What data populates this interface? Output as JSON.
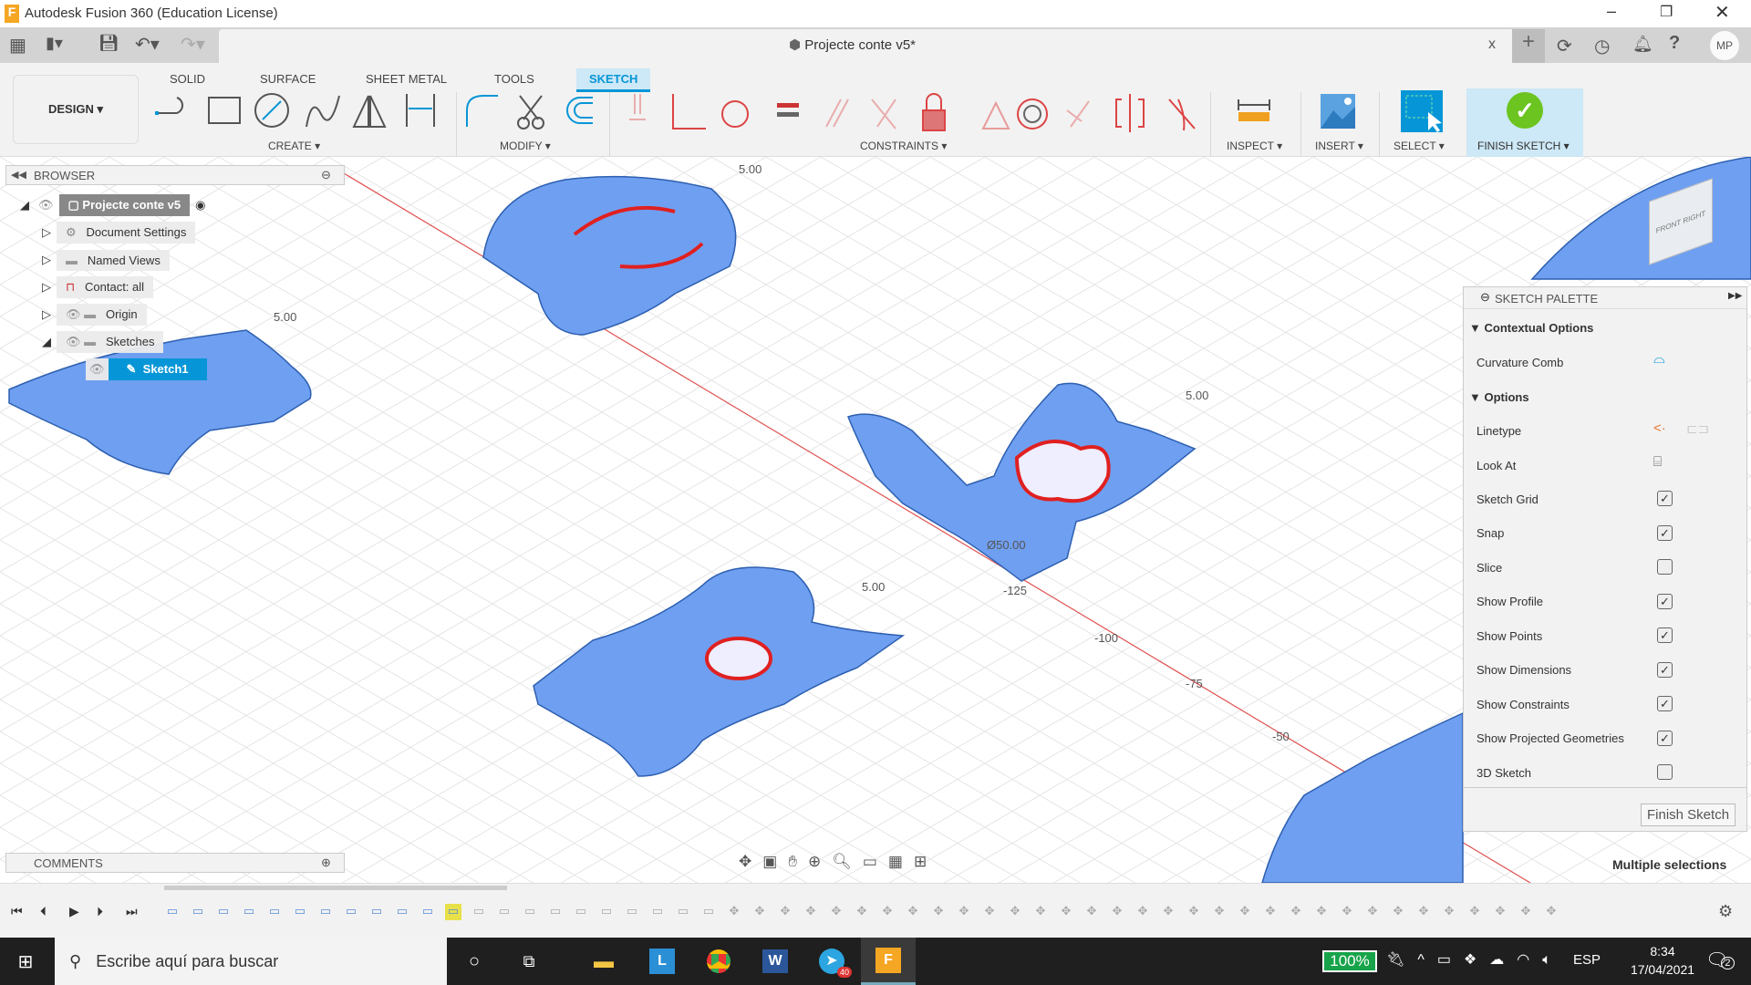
{
  "window": {
    "title": "Autodesk Fusion 360 (Education License)",
    "app_icon_letter": "F"
  },
  "document_tab": {
    "title": "Projecte conte v5*",
    "close": "x"
  },
  "account": {
    "initials": "MP"
  },
  "ribbon": {
    "workspace": "DESIGN ▾",
    "tabs": [
      {
        "label": "SOLID"
      },
      {
        "label": "SURFACE"
      },
      {
        "label": "SHEET METAL"
      },
      {
        "label": "TOOLS"
      },
      {
        "label": "SKETCH",
        "active": true
      }
    ],
    "groups": {
      "create": "CREATE ▾",
      "modify": "MODIFY ▾",
      "constraints": "CONSTRAINTS ▾",
      "inspect": "INSPECT ▾",
      "insert": "INSERT ▾",
      "select": "SELECT ▾",
      "finish": "FINISH SKETCH ▾"
    }
  },
  "browser": {
    "title": "BROWSER",
    "items": [
      {
        "label": "Projecte conte v5",
        "icon": "component-icon"
      },
      {
        "label": "Document Settings",
        "icon": "gear-icon"
      },
      {
        "label": "Named Views",
        "icon": "folder-icon"
      },
      {
        "label": "Contact: all",
        "icon": "contact-icon"
      },
      {
        "label": "Origin",
        "icon": "folder-icon"
      },
      {
        "label": "Sketches",
        "icon": "folder-icon"
      },
      {
        "label": "Sketch1",
        "icon": "sketch-icon",
        "selected": true
      }
    ]
  },
  "comments": {
    "title": "COMMENTS"
  },
  "palette": {
    "title": "SKETCH PALETTE",
    "contextual": "Contextual Options",
    "curvature": "Curvature Comb",
    "options": "Options",
    "linetype": "Linetype",
    "look_at": "Look At",
    "checks": [
      {
        "label": "Sketch Grid",
        "checked": true
      },
      {
        "label": "Snap",
        "checked": true
      },
      {
        "label": "Slice",
        "checked": false
      },
      {
        "label": "Show Profile",
        "checked": true
      },
      {
        "label": "Show Points",
        "checked": true
      },
      {
        "label": "Show Dimensions",
        "checked": true
      },
      {
        "label": "Show Constraints",
        "checked": true
      },
      {
        "label": "Show Projected Geometries",
        "checked": true
      },
      {
        "label": "3D Sketch",
        "checked": false
      }
    ],
    "finish": "Finish Sketch"
  },
  "viewport": {
    "status": "Multiple selections",
    "labels": [
      "5.00",
      "5.00",
      "5.00",
      "5.00",
      "-100",
      "-75",
      "-50",
      "Ø50.00",
      "-125"
    ],
    "colors": {
      "profile": "#6f9ff0",
      "axis": "#e05050",
      "selected": "#e02020"
    }
  },
  "taskbar": {
    "search_placeholder": "Escribe aquí para buscar",
    "battery": "100%",
    "lang": "ESP",
    "time": "8:34",
    "date": "17/04/2021",
    "notifications": "2",
    "telegram_badge": "40"
  }
}
